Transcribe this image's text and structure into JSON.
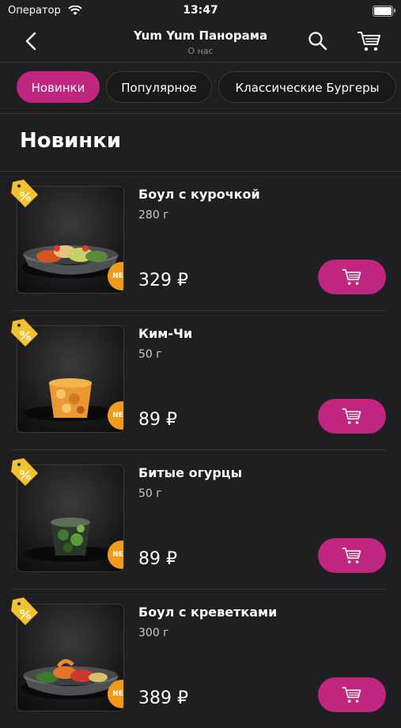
{
  "status_bar": {
    "carrier": "Оператор",
    "time": "13:47"
  },
  "navbar": {
    "title": "Yum Yum Панорама",
    "subtitle": "О нас",
    "back_icon": "chevron-left-icon",
    "search_icon": "search-icon",
    "cart_icon": "cart-icon"
  },
  "tabs": [
    {
      "label": "Новинки",
      "active": true
    },
    {
      "label": "Популярное",
      "active": false
    },
    {
      "label": "Классические Бургеры",
      "active": false
    }
  ],
  "section": {
    "title": "Новинки"
  },
  "products": [
    {
      "name": "Боул с курочкой",
      "weight": "280 г",
      "price": "329 ₽",
      "badge": "NEW",
      "discount_icon": "discount-tag-icon"
    },
    {
      "name": "Ким-Чи",
      "weight": "50 г",
      "price": "89 ₽",
      "badge": "NEW",
      "discount_icon": "discount-tag-icon"
    },
    {
      "name": "Битые огурцы",
      "weight": "50 г",
      "price": "89 ₽",
      "badge": "NEW",
      "discount_icon": "discount-tag-icon"
    },
    {
      "name": "Боул с креветками",
      "weight": "300 г",
      "price": "389 ₽",
      "badge": "NEW",
      "discount_icon": "discount-tag-icon"
    }
  ],
  "colors": {
    "accent": "#c0267f",
    "background": "#1f1f21",
    "badge": "#f19a1b",
    "tag": "#f2c12e"
  }
}
